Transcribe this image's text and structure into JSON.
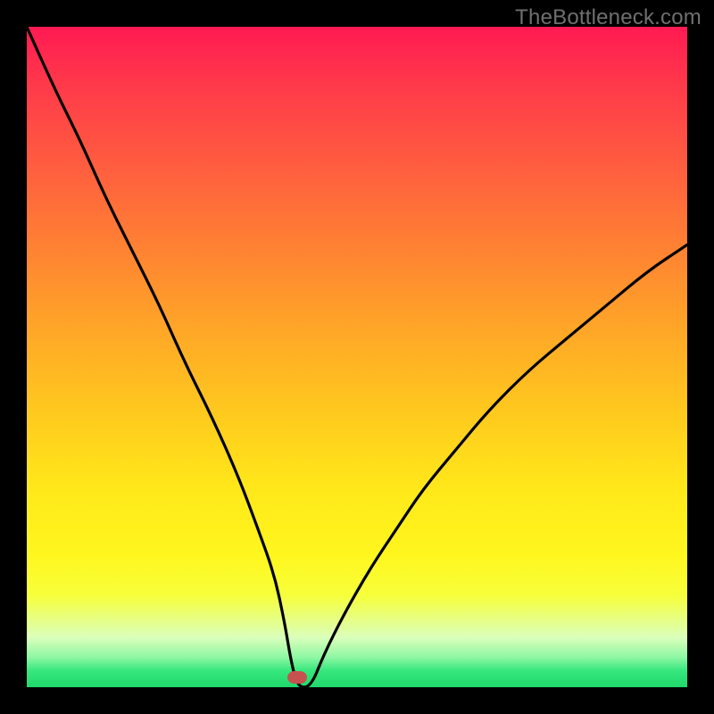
{
  "watermark": "TheBottleneck.com",
  "chart_data": {
    "type": "line",
    "title": "",
    "xlabel": "",
    "ylabel": "",
    "xlim": [
      0,
      100
    ],
    "ylim": [
      0,
      100
    ],
    "grid": false,
    "legend": false,
    "marker": {
      "x": 41,
      "y": 1.5,
      "color": "#c5524e"
    },
    "series": [
      {
        "name": "bottleneck-curve",
        "x": [
          0,
          4,
          8,
          12,
          16,
          20,
          24,
          28,
          32,
          35,
          37.5,
          39,
          40,
          41,
          43,
          45,
          48,
          52,
          56,
          60,
          65,
          70,
          76,
          82,
          88,
          94,
          100
        ],
        "y": [
          100,
          91,
          83,
          74,
          66,
          58,
          49,
          41,
          32,
          24,
          17,
          10,
          4,
          0,
          0,
          5,
          11,
          18,
          24,
          30,
          36,
          42,
          48,
          53,
          58,
          63,
          67
        ]
      }
    ],
    "gradient_stops": [
      {
        "pos": 0.0,
        "color": "#ff1a52"
      },
      {
        "pos": 0.2,
        "color": "#ff5a40"
      },
      {
        "pos": 0.45,
        "color": "#ffa428"
      },
      {
        "pos": 0.7,
        "color": "#ffe81a"
      },
      {
        "pos": 0.86,
        "color": "#f7ff3a"
      },
      {
        "pos": 0.955,
        "color": "#8df7a3"
      },
      {
        "pos": 1.0,
        "color": "#1fd86b"
      }
    ]
  }
}
